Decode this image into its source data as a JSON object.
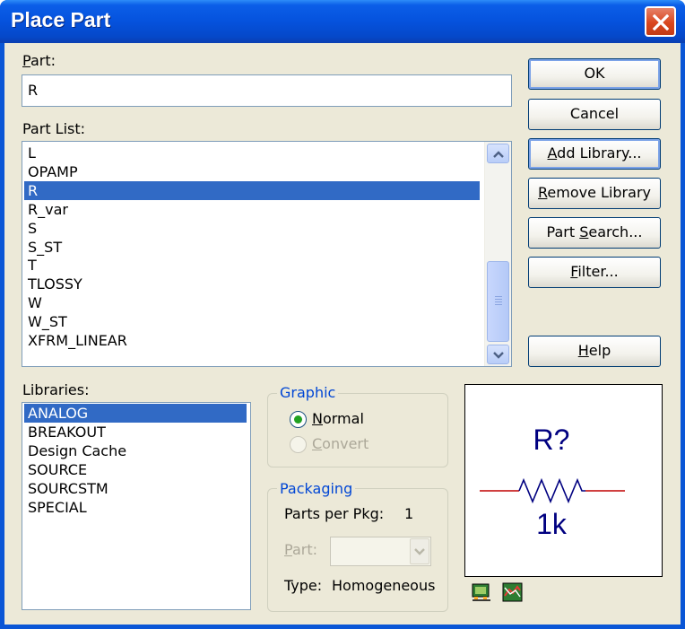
{
  "window": {
    "title": "Place Part",
    "close_icon": "close-icon"
  },
  "part": {
    "label_first": "P",
    "label_rest": "art:",
    "value": "R"
  },
  "part_list": {
    "label": "Part List:",
    "items": [
      "L",
      "OPAMP",
      "R",
      "R_var",
      "S",
      "S_ST",
      "T",
      "TLOSSY",
      "W",
      "W_ST",
      "XFRM_LINEAR"
    ],
    "selected_index": 2
  },
  "libraries": {
    "label": "Libraries:",
    "items": [
      "ANALOG",
      "BREAKOUT",
      "Design Cache",
      "SOURCE",
      "SOURCSTM",
      "SPECIAL"
    ],
    "selected_index": 0
  },
  "buttons": {
    "ok": "OK",
    "cancel": "Cancel",
    "add_library_first": "A",
    "add_library_rest": "dd Library...",
    "remove_library_first": "R",
    "remove_library_rest": "emove Library",
    "part_search_pre": "Part ",
    "part_search_u": "S",
    "part_search_rest": "earch...",
    "filter_first": "F",
    "filter_rest": "ilter...",
    "help_first": "H",
    "help_rest": "elp"
  },
  "graphic": {
    "legend": "Graphic",
    "normal_first": "N",
    "normal_rest": "ormal",
    "convert_first": "C",
    "convert_rest": "onvert",
    "selected": "Normal"
  },
  "packaging": {
    "legend": "Packaging",
    "parts_per_pkg_label": "Parts per Pkg:",
    "parts_per_pkg_value": "1",
    "part_label_first": "P",
    "part_label_rest": "art:",
    "part_value": "",
    "type_label": "Type:",
    "type_value": "Homogeneous"
  },
  "preview": {
    "refdes": "R?",
    "value": "1k"
  },
  "colors": {
    "titlebar": "#0552dd",
    "selection": "#316ac5",
    "group_legend": "#0046d5",
    "preview_wire": "#c00000",
    "preview_text": "#000080"
  }
}
